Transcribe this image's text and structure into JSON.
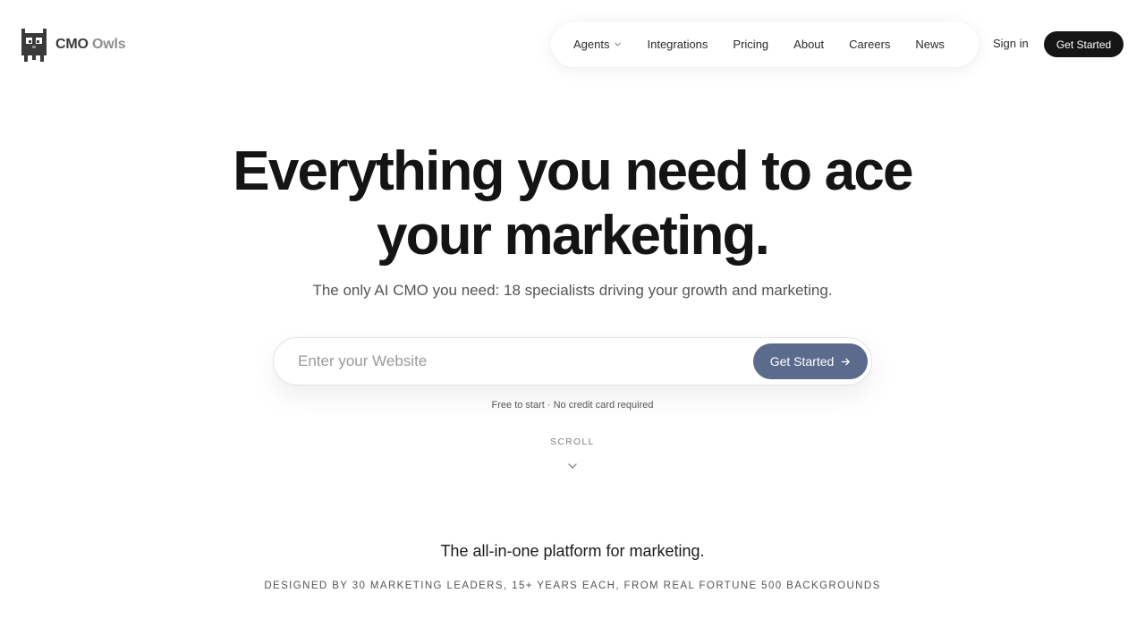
{
  "header": {
    "brand_primary": "CMO",
    "brand_secondary": "Owls",
    "logo_icon": "owl-pixel-icon",
    "nav": [
      {
        "label": "Agents",
        "has_dropdown": true
      },
      {
        "label": "Integrations"
      },
      {
        "label": "Pricing"
      },
      {
        "label": "About"
      },
      {
        "label": "Careers"
      },
      {
        "label": "News"
      }
    ],
    "sign_in_label": "Sign in",
    "cta_label": "Get Started"
  },
  "hero": {
    "headline_line1": "Everything you need to ace",
    "headline_line2": "your marketing.",
    "subheadline": "The only AI CMO you need: 18 specialists driving your growth and marketing.",
    "search": {
      "placeholder": "Enter your Website",
      "value": "",
      "button_label": "Get Started",
      "button_icon": "arrow-right-icon"
    },
    "fine_print": "Free to start · No credit card required",
    "scroll_label": "SCROLL",
    "scroll_icon": "chevron-down-icon"
  },
  "section": {
    "title": "The all-in-one platform for marketing.",
    "subtitle": "DESIGNED BY 30 MARKETING LEADERS, 15+ YEARS EACH, FROM REAL FORTUNE 500 BACKGROUNDS"
  },
  "colors": {
    "text": "#141414",
    "muted": "#555555",
    "cta_dark": "#151515",
    "search_button": "#5b6b8b",
    "logo": "#3a3a3a"
  }
}
